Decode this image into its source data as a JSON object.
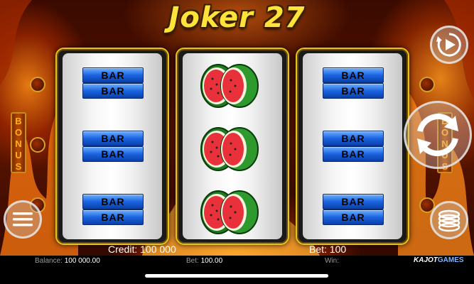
{
  "game": {
    "title": "Joker 27",
    "side_label": "BONUS",
    "credit_label": "Credit:",
    "credit_value": "100 000",
    "bet_label": "Bet:",
    "bet_value": "100"
  },
  "reels": {
    "left": [
      "BAR",
      "BAR",
      "BAR",
      "BAR",
      "BAR",
      "BAR"
    ],
    "middle": [
      "watermelon",
      "watermelon",
      "watermelon"
    ],
    "right": [
      "BAR",
      "BAR",
      "BAR",
      "BAR",
      "BAR",
      "BAR"
    ]
  },
  "footer": {
    "balance_label": "Balance:",
    "balance_value": "100 000.00",
    "bet_label": "Bet:",
    "bet_value": "100.00",
    "win_label": "Win:",
    "win_value": "",
    "brand_main": "KAJOT",
    "brand_sub": "GAMES"
  },
  "controls": {
    "autoplay_icon": "play-circle-icon",
    "spin_icon": "spin-arrows-icon",
    "menu_icon": "hamburger-menu-icon",
    "bet_icon": "coin-stack-icon"
  },
  "colors": {
    "title": "#ffe23a",
    "reel_frame": "#e7c21a",
    "bar_symbol": "#1a63e0"
  }
}
